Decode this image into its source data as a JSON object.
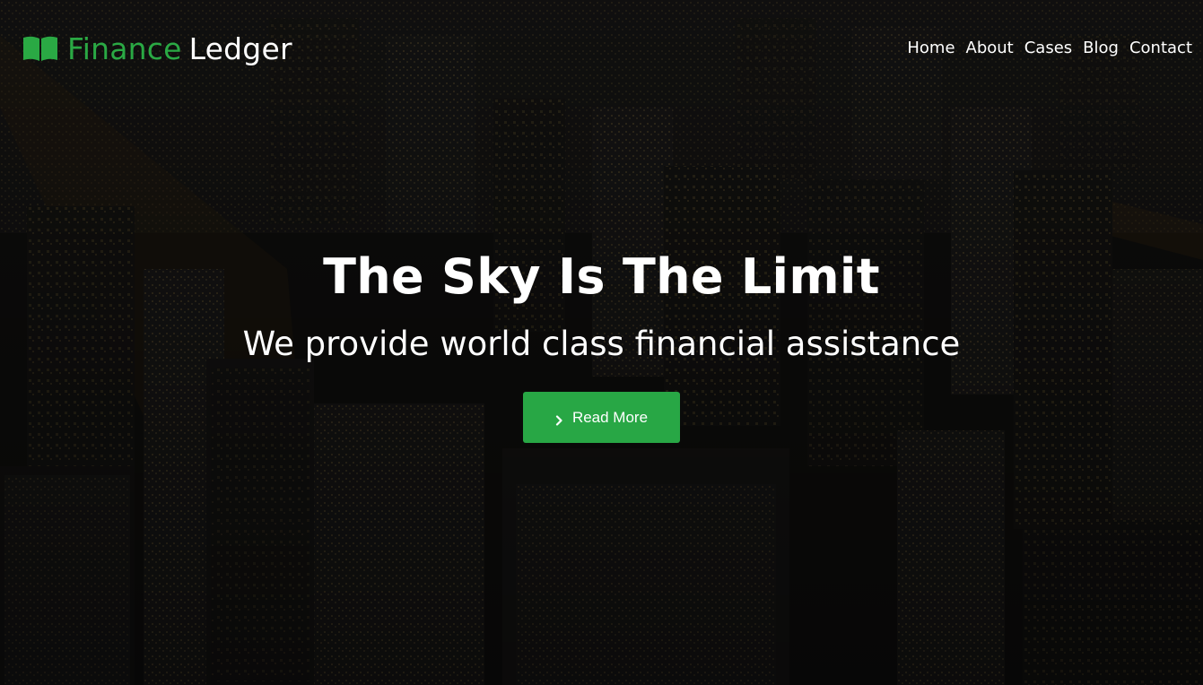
{
  "brand": {
    "name_first": "Finance",
    "name_second": "Ledger",
    "icon": "open-book-icon",
    "accent_color": "#2aa944"
  },
  "nav": {
    "items": [
      {
        "label": "Home"
      },
      {
        "label": "About"
      },
      {
        "label": "Cases"
      },
      {
        "label": "Blog"
      },
      {
        "label": "Contact"
      }
    ]
  },
  "hero": {
    "headline": "The Sky Is The Limit",
    "subheadline": "We provide world class financial assistance",
    "cta": {
      "label": "Read More",
      "icon": "chevron-right-icon",
      "color": "#28a745"
    },
    "background": "night-city-aerial-photo"
  }
}
